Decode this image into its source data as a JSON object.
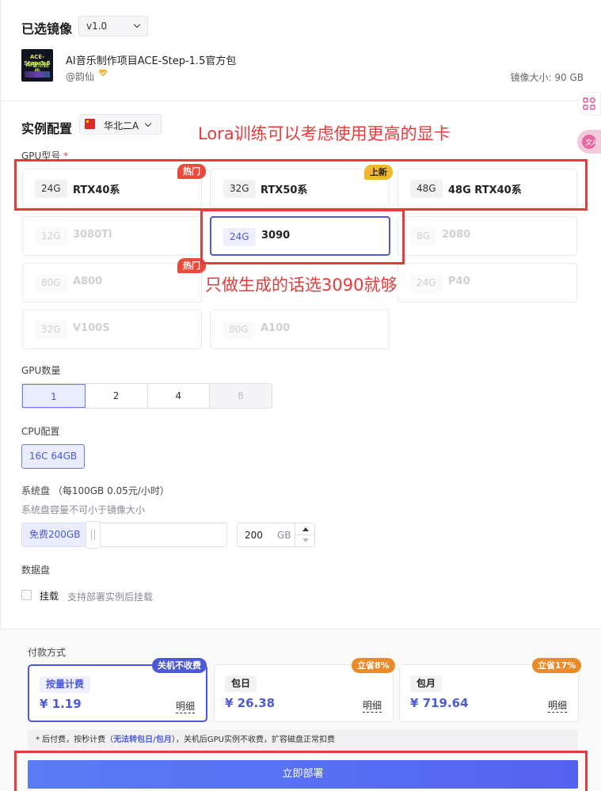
{
  "image": {
    "title": "已选镜像",
    "version": "v1.0",
    "thumb_lines": [
      "ACE-Step-1.5",
      "AI音乐制作"
    ],
    "name": "AI音乐制作项目ACE-Step-1.5官方包",
    "author": "@韵仙",
    "size_label": "镜像大小: 90 GB"
  },
  "instance": {
    "title": "实例配置",
    "region": "华北二A",
    "gpu_label": "GPU型号",
    "required_mark": "*",
    "gpus": [
      {
        "mem": "24G",
        "model": "RTX40系",
        "state": "normal"
      },
      {
        "mem": "32G",
        "model": "RTX50系",
        "state": "normal"
      },
      {
        "mem": "48G",
        "model": "48G RTX40系",
        "state": "normal"
      },
      {
        "mem": "12G",
        "model": "3080Ti",
        "state": "disabled"
      },
      {
        "mem": "24G",
        "model": "3090",
        "state": "selected"
      },
      {
        "mem": "8G",
        "model": "2080",
        "state": "disabled"
      },
      {
        "mem": "80G",
        "model": "A800",
        "state": "disabled"
      },
      {
        "mem": "24G",
        "model": "P40",
        "state": "disabled"
      },
      {
        "mem": "32G",
        "model": "V100S",
        "state": "disabled"
      },
      {
        "mem": "80G",
        "model": "A100",
        "state": "disabled"
      }
    ],
    "tags": {
      "hot": "热门",
      "new": "上新"
    },
    "annotation_top": "Lora训练可以考虑使用更高的显卡",
    "annotation_mid": "只做生成的话选3090就够",
    "gpu_count_label": "GPU数量",
    "gpu_counts": [
      "1",
      "2",
      "4",
      "8"
    ],
    "gpu_count_selected": "1",
    "cpu_label": "CPU配置",
    "cpu_value": "16C 64GB",
    "disk_label": "系统盘",
    "disk_price": "（每100GB 0.05元/小时）",
    "disk_hint": "系统盘容量不可小于镜像大小",
    "disk_free": "免费200GB",
    "disk_value": "200",
    "disk_unit": "GB",
    "data_disk_label": "数据盘",
    "mount_label": "挂载",
    "mount_hint": "支持部署实例后挂载"
  },
  "payment": {
    "title": "付款方式",
    "options": [
      {
        "name": "按量计费",
        "price": "¥ 1.19",
        "detail": "明细",
        "tag": "关机不收费",
        "selected": true
      },
      {
        "name": "包日",
        "price": "¥ 26.38",
        "detail": "明细",
        "tag": "立省8%",
        "selected": false
      },
      {
        "name": "包月",
        "price": "¥ 719.64",
        "detail": "明细",
        "tag": "立省17%",
        "selected": false
      }
    ],
    "note_pre": "* 后付费，按秒计费（",
    "note_blue": "无法转包日/包月",
    "note_post": "），关机后GPU实例不收费，扩容磁盘正常扣费",
    "deploy": "立即部署"
  },
  "colors": {
    "accent": "#4c59d9",
    "annotation_red": "#e83a3a",
    "hot": "#e84a3b",
    "new": "#f0b82b"
  },
  "icons": [
    "chevron-down-icon",
    "heart-badge-icon",
    "apps-icon",
    "translate-icon",
    "china-flag-icon",
    "stepper-up-icon",
    "stepper-down-icon"
  ]
}
